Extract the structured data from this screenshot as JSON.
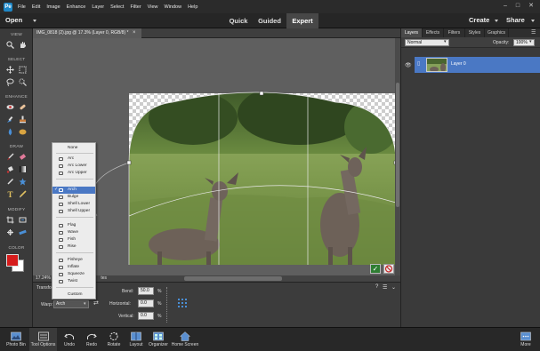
{
  "menu": {
    "items": [
      "File",
      "Edit",
      "Image",
      "Enhance",
      "Layer",
      "Select",
      "Filter",
      "View",
      "Window",
      "Help"
    ]
  },
  "mode_bar": {
    "open_label": "Open",
    "modes": [
      "Quick",
      "Guided",
      "Expert"
    ],
    "active_mode": "Expert",
    "create_label": "Create",
    "share_label": "Share"
  },
  "tools": {
    "sections": [
      "VIEW",
      "SELECT",
      "ENHANCE",
      "DRAW",
      "MODIFY",
      "COLOR"
    ],
    "foreground_color": "#d61c1c",
    "background_color": "#ffffff"
  },
  "document": {
    "tab_title": "IMG_0818 (2).jpg @ 17.3% (Layer 0, RGB/8) *",
    "zoom": "17.24%",
    "status_suffix": "tes"
  },
  "warp_menu": {
    "items": [
      {
        "label": "None",
        "icon": "none-icon",
        "group": 0
      },
      {
        "label": "Arc",
        "icon": "arc-icon",
        "group": 1
      },
      {
        "label": "Arc Lower",
        "icon": "arc-lower-icon",
        "group": 1
      },
      {
        "label": "Arc Upper",
        "icon": "arc-upper-icon",
        "group": 1
      },
      {
        "label": "Arch",
        "icon": "arch-icon",
        "group": 2,
        "selected": true
      },
      {
        "label": "Bulge",
        "icon": "bulge-icon",
        "group": 2
      },
      {
        "label": "Shell Lower",
        "icon": "shell-lower-icon",
        "group": 2
      },
      {
        "label": "Shell Upper",
        "icon": "shell-upper-icon",
        "group": 2
      },
      {
        "label": "Flag",
        "icon": "flag-icon",
        "group": 3
      },
      {
        "label": "Wave",
        "icon": "wave-icon",
        "group": 3
      },
      {
        "label": "Fish",
        "icon": "fish-icon",
        "group": 3
      },
      {
        "label": "Rise",
        "icon": "rise-icon",
        "group": 3
      },
      {
        "label": "Fisheye",
        "icon": "fisheye-icon",
        "group": 4
      },
      {
        "label": "Inflate",
        "icon": "inflate-icon",
        "group": 4
      },
      {
        "label": "Squeeze",
        "icon": "squeeze-icon",
        "group": 4
      },
      {
        "label": "Twist",
        "icon": "twist-icon",
        "group": 4
      },
      {
        "label": "Custom",
        "icon": "custom-icon",
        "group": 5
      }
    ]
  },
  "options": {
    "transform_label": "Transfo",
    "warp_label": "Warp:",
    "warp_value": "Arch",
    "bend_label": "Bend:",
    "bend_value": "50.0",
    "horizontal_label": "Horizontal:",
    "horizontal_value": "0.0",
    "vertical_label": "Vertical:",
    "vertical_value": "0.0",
    "percent": "%"
  },
  "panel": {
    "tabs": [
      "Layers",
      "Effects",
      "Filters",
      "Styles",
      "Graphics"
    ],
    "active_tab": "Layers",
    "blend_mode": "Normal",
    "opacity_label": "Opacity:",
    "opacity_value": "100%",
    "layer_name": "Layer 0"
  },
  "bottom_bar": {
    "left": [
      "Photo Bin",
      "Tool Options",
      "Undo",
      "Redo",
      "Rotate",
      "Layout",
      "Organizer",
      "Home Screen"
    ],
    "active": "Tool Options",
    "right": [
      "More"
    ]
  }
}
